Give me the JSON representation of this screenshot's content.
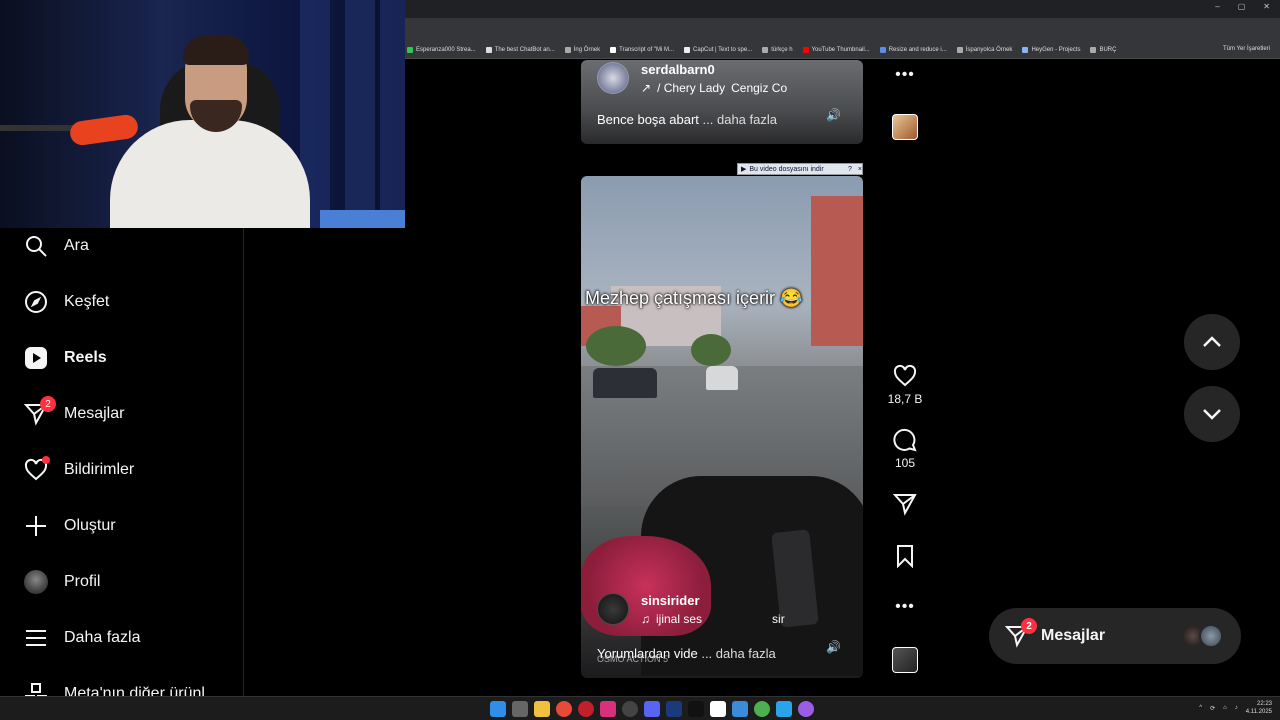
{
  "browser": {
    "bookmarks": [
      "Esperanza000 Strea...",
      "The best ChatBot an...",
      "İng Örnek",
      "Transcript of \"Mi M...",
      "CapCut | Text to spe...",
      "türkçe h",
      "YouTube Thumbnail...",
      "Resize and reduce i...",
      "İspanyolca Örnek",
      "HeyGen - Projects",
      "BURÇ"
    ],
    "bookmarks_right": "Tüm Yer İşaretleri",
    "window_controls": [
      "–",
      "▢",
      "✕"
    ]
  },
  "sidebar": {
    "items": [
      {
        "label": "Ara",
        "icon": "search-icon"
      },
      {
        "label": "Keşfet",
        "icon": "compass-icon"
      },
      {
        "label": "Reels",
        "icon": "reels-icon"
      },
      {
        "label": "Mesajlar",
        "icon": "messenger-icon",
        "badge": "2"
      },
      {
        "label": "Bildirimler",
        "icon": "heart-icon"
      },
      {
        "label": "Oluştur",
        "icon": "plus-icon"
      },
      {
        "label": "Profil",
        "icon": "avatar"
      },
      {
        "label": "Daha fazla",
        "icon": "menu-icon"
      },
      {
        "label": "Meta'nın diğer ürünl",
        "icon": "meta-icon"
      }
    ]
  },
  "reel_top": {
    "username": "serdalbarn0",
    "audio_prefix": "/ Chery Lady",
    "audio_artist": "Cengiz Co",
    "caption": "Bence boşa abart",
    "more": "... daha fazla"
  },
  "reel_main": {
    "overlay_text": "Mezhep çatışması içerir 😂",
    "username": "sinsirider",
    "audio": "ijinal ses",
    "audio_extra": "sir",
    "caption": "Yorumlardan vide",
    "more": "... daha fazla",
    "watermark": "OSMO ACTION 5"
  },
  "download_banner": {
    "label": "Bu video dosyasını indir",
    "counter": "?",
    "close": "×"
  },
  "actions": {
    "likes": "18,7 B",
    "comments": "105"
  },
  "messages_pill": {
    "label": "Mesajlar",
    "badge": "2"
  },
  "taskbar": {
    "time": "22:23",
    "date": "4.11.2025"
  },
  "colors": {
    "badge": "#ff3040",
    "pill_bg": "#262626",
    "background": "#000000"
  }
}
